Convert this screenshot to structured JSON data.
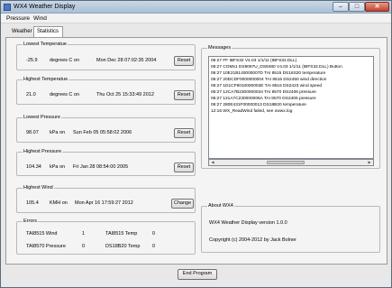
{
  "window": {
    "title": "WX4 Weather Display",
    "minimize_glyph": "–",
    "maximize_glyph": "□",
    "close_glyph": "✕"
  },
  "menu": {
    "items": [
      "Pressure",
      "Wind"
    ]
  },
  "tabs": {
    "weather": "Weather",
    "statistics": "Statistics"
  },
  "lowest_temp": {
    "title": "Lowest Temperatue",
    "value": "-25.9",
    "unit": "degrees C on",
    "date": "Mon Dec 28 07:02:35 2004",
    "button": "Reset"
  },
  "highest_temp": {
    "title": "Highest Temperatue",
    "value": "21.0",
    "unit": "degrees C on",
    "date": "Thu Oct 25 15:33:49 2012",
    "button": "Reset"
  },
  "lowest_pressure": {
    "title": "Lowest Pressure",
    "value": "98.07",
    "unit": "kPa on",
    "date": "Sun Feb 05 05:58:02 2006",
    "button": "Reset"
  },
  "highest_pressure": {
    "title": "Highest Pressure",
    "value": "104.34",
    "unit": "kPa on",
    "date": "Fri Jan 28 08:54:00 2005",
    "button": "Reset"
  },
  "highest_wind": {
    "title": "Highest Wind",
    "value": "105.4",
    "unit": "KMH on",
    "date": "Mon Apr 16 17:59:27 2012",
    "button": "Change"
  },
  "errors": {
    "title": "Errors",
    "rows": [
      {
        "label1": "TAI8515 Wind",
        "value1": "1",
        "label2": "TAI8515 Temp",
        "value2": "0"
      },
      {
        "label1": "TAI8570 Pressure",
        "value1": "0",
        "label2": "DS18B20 Temp",
        "value2": "0"
      }
    ]
  },
  "messages": {
    "title": "Messages",
    "lines": [
      "06:27 FF IBFS32 V4.03 1/1/11 (IBFS32.DLL)",
      "06:27 COMs1 DS9097U_DS9480 V4.03 1/1/11 (IBFS32.DLL) Button",
      "06:27 10E21B140000007D TAI 8515 DS18S20 temperature",
      "06:27 20DCDF0000000004 TAI 8515 DS2450 wind direction",
      "06:27 1D1CF8010000003E TAI 8515 DS2423 wind speed",
      "06:27 12CA7B2300000034 TAI 8570 DS2406 pressure",
      "06:27 121A7C230000006A TAI 8570 DS2406 pressure",
      "06:27 280E431F00000013 DS18B20 temperature",
      "12:16 WX_ReadWind failed, see owwx.log"
    ]
  },
  "about": {
    "title": "About WX4",
    "version": "WX4 Weather Display version 1.0.0",
    "copyright": "Copyright (c) 2004-2012 by Jack Bolner"
  },
  "footer": {
    "end_button": "End Program"
  },
  "scroll": {
    "left_arrow": "◀",
    "right_arrow": "▶"
  }
}
